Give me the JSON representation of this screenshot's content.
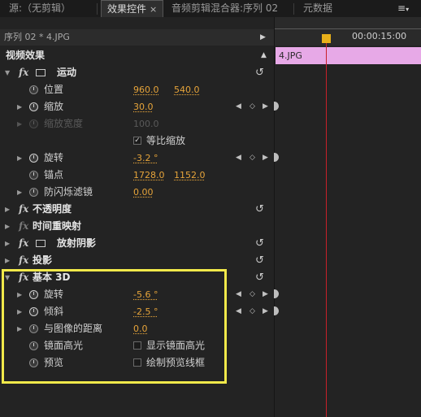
{
  "tabs": {
    "source": "源:（无剪辑）",
    "effect_controls": "效果控件",
    "effect_controls_close": "×",
    "mixer": "音频剪辑混合器:序列 02",
    "metadata": "元数据",
    "menu": "≡"
  },
  "panel": {
    "sequence_title": "序列 02 * 4.JPG",
    "video_effects": "视频效果",
    "timecode": "00:00:15:00",
    "clip_name": "4.JPG"
  },
  "effects": {
    "motion": {
      "name": "运动",
      "position_label": "位置",
      "position_x": "960.0",
      "position_y": "540.0",
      "scale_label": "缩放",
      "scale_value": "30.0",
      "scale_width_label": "缩放宽度",
      "scale_width_value": "100.0",
      "uniform_scale_label": "等比缩放",
      "rotation_label": "旋转",
      "rotation_value": "-3.2 °",
      "anchor_label": "锚点",
      "anchor_x": "1728.0",
      "anchor_y": "1152.0",
      "antiflicker_label": "防闪烁滤镜",
      "antiflicker_value": "0.00"
    },
    "opacity": {
      "name": "不透明度"
    },
    "time_remap": {
      "name": "时间重映射"
    },
    "radial_shadow": {
      "name": "放射阴影"
    },
    "drop_shadow": {
      "name": "投影"
    },
    "basic3d": {
      "name": "基本 3D",
      "swivel_label": "旋转",
      "swivel_value": "-5.6 °",
      "tilt_label": "倾斜",
      "tilt_value": "-2.5 °",
      "distance_label": "与图像的距离",
      "distance_value": "0.0",
      "specular_label": "镜面高光",
      "specular_option": "显示镜面高光",
      "preview_label": "预览",
      "preview_option": "绘制预览线框"
    }
  },
  "glyphs": {
    "fx": "fx",
    "twirl_open": "▼",
    "twirl_closed": "▶",
    "reset": "↺",
    "key_prev": "◀",
    "key_add": "◇",
    "key_next": "▶",
    "check": "✓"
  }
}
